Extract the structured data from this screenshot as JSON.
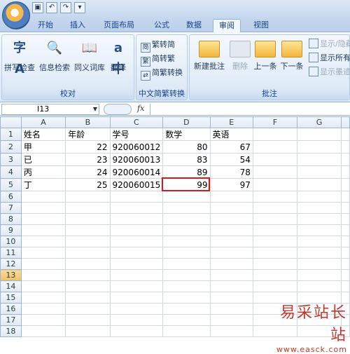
{
  "quick_access": [
    "save-icon",
    "undo-icon",
    "redo-icon",
    "customize-icon"
  ],
  "tabs": [
    "开始",
    "插入",
    "页面布局",
    "公式",
    "数据",
    "审阅",
    "视图"
  ],
  "active_tab": "审阅",
  "ribbon": {
    "proofing": {
      "label": "校对",
      "buttons": [
        "拼写检查",
        "信息检索",
        "同义词库",
        "翻译"
      ]
    },
    "chinese_conversion": {
      "label": "中文简繁转换",
      "buttons": [
        "繁转简",
        "简转繁",
        "简繁转换"
      ]
    },
    "comments": {
      "label": "批注",
      "buttons": [
        "新建批注",
        "删除",
        "上一条",
        "下一条"
      ],
      "side_buttons": [
        "显示/隐藏",
        "显示所有",
        "显示墨迹"
      ]
    }
  },
  "formula_bar": {
    "name_box": "I13",
    "fx": "fx",
    "content": ""
  },
  "sheet": {
    "columns": [
      "A",
      "B",
      "C",
      "D",
      "E",
      "F",
      "G"
    ],
    "rows": [
      [
        "姓名",
        "年龄",
        "学号",
        "数学",
        "英语",
        "",
        ""
      ],
      [
        "甲",
        "22",
        "920060012",
        "80",
        "67",
        "",
        ""
      ],
      [
        "已",
        "23",
        "920060013",
        "83",
        "54",
        "",
        ""
      ],
      [
        "丙",
        "24",
        "920060014",
        "89",
        "78",
        "",
        ""
      ],
      [
        "丁",
        "25",
        "920060015",
        "99",
        "97",
        "",
        ""
      ],
      [
        "",
        "",
        "",
        "",
        "",
        "",
        ""
      ],
      [
        "",
        "",
        "",
        "",
        "",
        "",
        ""
      ],
      [
        "",
        "",
        "",
        "",
        "",
        "",
        ""
      ],
      [
        "",
        "",
        "",
        "",
        "",
        "",
        ""
      ],
      [
        "",
        "",
        "",
        "",
        "",
        "",
        ""
      ],
      [
        "",
        "",
        "",
        "",
        "",
        "",
        ""
      ],
      [
        "",
        "",
        "",
        "",
        "",
        "",
        ""
      ],
      [
        "",
        "",
        "",
        "",
        "",
        "",
        ""
      ],
      [
        "",
        "",
        "",
        "",
        "",
        "",
        ""
      ],
      [
        "",
        "",
        "",
        "",
        "",
        "",
        ""
      ],
      [
        "",
        "",
        "",
        "",
        "",
        "",
        ""
      ],
      [
        "",
        "",
        "",
        "",
        "",
        "",
        ""
      ],
      [
        "",
        "",
        "",
        "",
        "",
        "",
        ""
      ]
    ],
    "row_numbers": [
      "1",
      "2",
      "3",
      "4",
      "5",
      "6",
      "7",
      "8",
      "9",
      "10",
      "11",
      "12",
      "13",
      "14",
      "15",
      "16",
      "17",
      "18"
    ],
    "selected_row": "13"
  },
  "watermark": {
    "title": "易采站长站",
    "url": "www.easck.com"
  },
  "colors": {
    "highlight": "#d21b1b",
    "tab_text": "#15428b"
  }
}
